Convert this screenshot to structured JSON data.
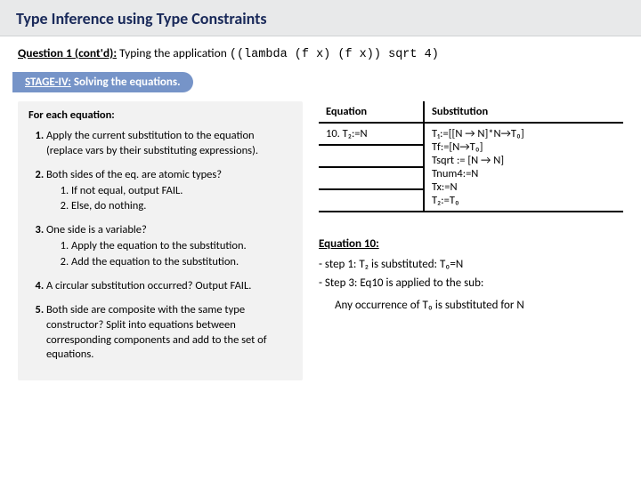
{
  "title": "Type Inference using Type Constraints",
  "question": {
    "label": "Question 1 (cont'd):",
    "text": "Typing the application",
    "code": "((lambda (f x)  (f x)) sqrt 4)"
  },
  "stage": {
    "prefix": "STAGE-IV:",
    "rest": " Solving the equations."
  },
  "algo": {
    "header": "For each equation:",
    "items": [
      {
        "text": "Apply the current substitution to the equation (replace vars by their substituting expressions)."
      },
      {
        "text": "Both sides of the eq. are atomic types?",
        "sub": [
          "If not equal, output FAIL.",
          "Else, do nothing."
        ]
      },
      {
        "text": "One side is a variable?",
        "sub": [
          "Apply the equation to the substitution.",
          "Add the equation to the substitution."
        ]
      },
      {
        "text": "A circular substitution occurred? Output FAIL."
      },
      {
        "text": "Both side are composite with the same type constructor? Split into equations between corresponding components and add to the set of equations."
      }
    ]
  },
  "table": {
    "headers": [
      "Equation",
      "Substitution"
    ],
    "equation_cell": "10. T₂:=N",
    "subst_lines": [
      "T₁:=[[N → N]*N→T₀]",
      "Tf:=[N→T₀]",
      "Tsqrt := [N → N]",
      "Tnum4:=N",
      "Tx:=N",
      "T₂:=T₀"
    ],
    "blank_rows": 3
  },
  "eq10": {
    "heading": "Equation 10:",
    "bullets": [
      "step 1: T₂ is substituted: T₀=N",
      "Step 3: Eq10 is applied to the sub:"
    ],
    "any": "Any occurrence of T₀ is substituted for N"
  }
}
